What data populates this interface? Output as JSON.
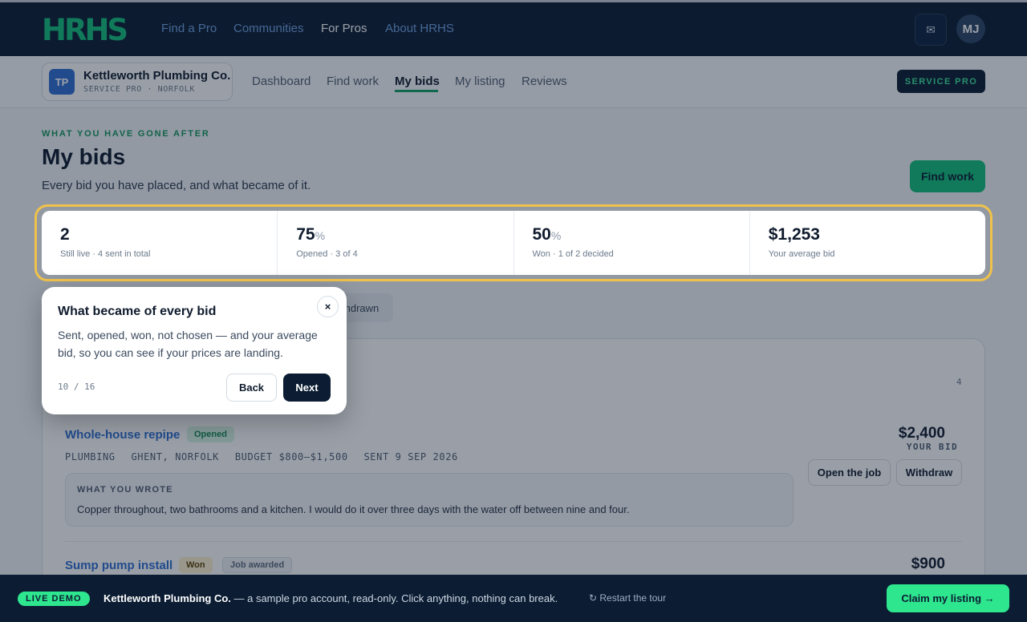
{
  "brand": {
    "logo_text": "HRHS"
  },
  "topnav": {
    "links": [
      "Find a Pro",
      "Communities",
      "For Pros",
      "About HRHS"
    ],
    "mail_icon": "mail-icon",
    "avatar_initials": "MJ"
  },
  "subnav": {
    "company_initials": "TP",
    "company_name": "Kettleworth Plumbing Co.",
    "company_meta": "SERVICE PRO · NORFOLK",
    "tabs": [
      "Dashboard",
      "Find work",
      "My bids",
      "My listing",
      "Reviews"
    ],
    "active_tab": "My bids",
    "role_badge": "SERVICE PRO"
  },
  "header": {
    "eyebrow": "WHAT YOU HAVE GONE AFTER",
    "title": "My bids",
    "subtitle": "Every bid you have placed, and what became of it.",
    "cta": "Find work"
  },
  "stats": [
    {
      "value": "2",
      "unit": "",
      "label": "Still live · 4 sent in total"
    },
    {
      "value": "75",
      "unit": "%",
      "label": "Opened · 3 of 4"
    },
    {
      "value": "50",
      "unit": "%",
      "label": "Won · 1 of 2 decided"
    },
    {
      "value": "$1,253",
      "unit": "",
      "label": "Your average bid"
    }
  ],
  "filters": {
    "visible_chip": "thdrawn"
  },
  "list": {
    "count": "4",
    "bids": [
      {
        "title": "Whole-house repipe",
        "status": "Opened",
        "meta": [
          "PLUMBING",
          "GHENT, NORFOLK",
          "BUDGET $800–$1,500",
          "SENT 9 SEP 2026"
        ],
        "wrote_label": "WHAT YOU WROTE",
        "wrote_text": "Copper throughout, two bathrooms and a kitchen. I would do it over three days with the water off between nine and four.",
        "amount": "$2,400",
        "amount_label": "YOUR BID",
        "actions": [
          "Open the job",
          "Withdraw"
        ]
      },
      {
        "title": "Sump pump install",
        "status": "Won",
        "extra_badge": "Job awarded",
        "amount": "$900"
      }
    ]
  },
  "tour": {
    "title": "What became of every bid",
    "body": "Sent, opened, won, not chosen — and your average bid, so you can see if your prices are landing.",
    "step": "10 / 16",
    "back": "Back",
    "next": "Next",
    "close": "×"
  },
  "demo_bar": {
    "badge": "LIVE DEMO",
    "company": "Kettleworth Plumbing Co.",
    "text": " — a sample pro account, read-only. Click anything, nothing can break.",
    "restart": "↻ Restart the tour",
    "claim": "Claim my listing →"
  },
  "colors": {
    "navy": "#0b1c33",
    "green": "#13c07a",
    "highlight": "#f0c24a",
    "link_blue": "#2f6fd1"
  }
}
